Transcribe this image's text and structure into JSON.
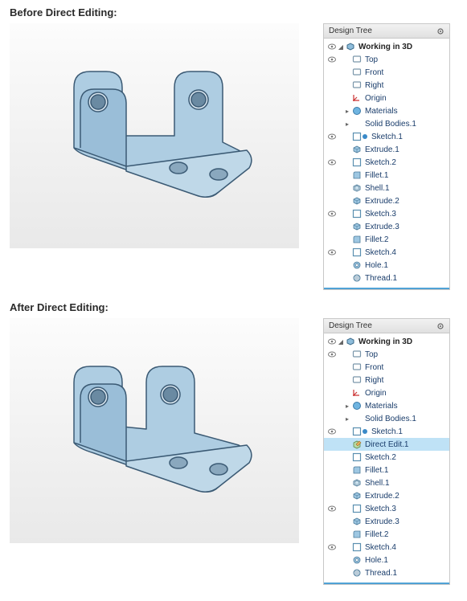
{
  "headings": {
    "before": "Before Direct Editing:",
    "after": "After Direct Editing:"
  },
  "panel_title": "Design Tree",
  "tree_before": {
    "root": "Working in 3D",
    "items": [
      {
        "label": "Top",
        "icon": "plane",
        "eye": true
      },
      {
        "label": "Front",
        "icon": "plane",
        "eye": false
      },
      {
        "label": "Right",
        "icon": "plane",
        "eye": false
      },
      {
        "label": "Origin",
        "icon": "origin",
        "eye": false
      },
      {
        "label": "Materials",
        "icon": "materials",
        "eye": false,
        "expander": "right"
      },
      {
        "label": "Solid Bodies.1",
        "icon": "",
        "eye": false,
        "expander": "right"
      },
      {
        "label": "Sketch.1",
        "icon": "sketch",
        "eye": true,
        "dot": "blue"
      },
      {
        "label": "Extrude.1",
        "icon": "extrude",
        "eye": false
      },
      {
        "label": "Sketch.2",
        "icon": "sketch",
        "eye": true
      },
      {
        "label": "Fillet.1",
        "icon": "fillet",
        "eye": false
      },
      {
        "label": "Shell.1",
        "icon": "shell",
        "eye": false
      },
      {
        "label": "Extrude.2",
        "icon": "extrude",
        "eye": false
      },
      {
        "label": "Sketch.3",
        "icon": "sketch",
        "eye": true
      },
      {
        "label": "Extrude.3",
        "icon": "extrude",
        "eye": false
      },
      {
        "label": "Fillet.2",
        "icon": "fillet",
        "eye": false
      },
      {
        "label": "Sketch.4",
        "icon": "sketch",
        "eye": true
      },
      {
        "label": "Hole.1",
        "icon": "hole",
        "eye": false
      },
      {
        "label": "Thread.1",
        "icon": "thread",
        "eye": false
      }
    ]
  },
  "tree_after": {
    "root": "Working in 3D",
    "items": [
      {
        "label": "Top",
        "icon": "plane",
        "eye": true
      },
      {
        "label": "Front",
        "icon": "plane",
        "eye": false
      },
      {
        "label": "Right",
        "icon": "plane",
        "eye": false
      },
      {
        "label": "Origin",
        "icon": "origin",
        "eye": false
      },
      {
        "label": "Materials",
        "icon": "materials",
        "eye": false,
        "expander": "right"
      },
      {
        "label": "Solid Bodies.1",
        "icon": "",
        "eye": false,
        "expander": "right"
      },
      {
        "label": "Sketch.1",
        "icon": "sketch",
        "eye": true,
        "dot": "blue"
      },
      {
        "label": "Direct Edit.1",
        "icon": "directedit",
        "eye": false,
        "highlight": true
      },
      {
        "label": "Sketch.2",
        "icon": "sketch",
        "eye": false
      },
      {
        "label": "Fillet.1",
        "icon": "fillet",
        "eye": false
      },
      {
        "label": "Shell.1",
        "icon": "shell",
        "eye": false
      },
      {
        "label": "Extrude.2",
        "icon": "extrude",
        "eye": false
      },
      {
        "label": "Sketch.3",
        "icon": "sketch",
        "eye": true
      },
      {
        "label": "Extrude.3",
        "icon": "extrude",
        "eye": false
      },
      {
        "label": "Fillet.2",
        "icon": "fillet",
        "eye": false
      },
      {
        "label": "Sketch.4",
        "icon": "sketch",
        "eye": true
      },
      {
        "label": "Hole.1",
        "icon": "hole",
        "eye": false
      },
      {
        "label": "Thread.1",
        "icon": "thread",
        "eye": false
      }
    ]
  },
  "colors": {
    "part_fill": "#a9c8df",
    "part_edge": "#3b5a74",
    "highlight": "#bfe2f6",
    "underline": "#4fa2d6"
  }
}
